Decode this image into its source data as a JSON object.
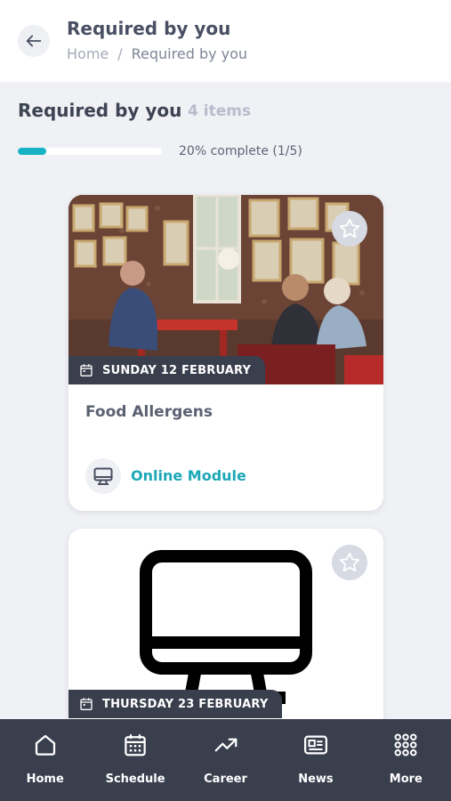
{
  "header": {
    "title": "Required by you",
    "breadcrumb": {
      "home": "Home",
      "separator": "/",
      "current": "Required by you"
    }
  },
  "section": {
    "title": "Required by you",
    "count": "4 items",
    "progress_fraction": 0.2,
    "progress_text": "20% complete (1/5)"
  },
  "cards": [
    {
      "date": "SUNDAY 12 FEBRUARY",
      "title": "Food Allergens",
      "module_type": "Online Module",
      "image": "cafe-photo"
    },
    {
      "date": "THURSDAY 23 FEBRUARY",
      "image": "monitor-icon-image"
    }
  ],
  "nav": [
    {
      "label": "Home",
      "icon": "home-icon"
    },
    {
      "label": "Schedule",
      "icon": "calendar-icon"
    },
    {
      "label": "Career",
      "icon": "trending-up-icon"
    },
    {
      "label": "News",
      "icon": "newspaper-icon"
    },
    {
      "label": "More",
      "icon": "grid-icon"
    }
  ],
  "colors": {
    "accent": "#17b3c5",
    "nav_bg": "#3a3f4e",
    "page_bg": "#f0f1f5"
  }
}
